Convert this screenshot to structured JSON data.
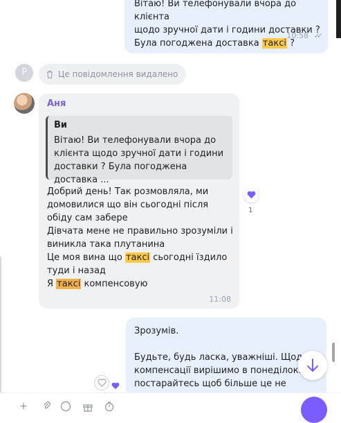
{
  "colors": {
    "accent": "#7b5cff",
    "highlight": "#ffc94a",
    "outgoing_bg": "#e9f0fd",
    "incoming_bg": "#f0f1f3"
  },
  "messages": {
    "outgoing1": {
      "line1": "Вітаю! Ви телефонували вчора до клієнта",
      "line2": "щодо зручної дати і години доставки ?",
      "line3_before": "Була погоджена доставка ",
      "line3_highlight": "таксі",
      "line3_after": " ?",
      "time": "10:58",
      "read_icon": "double-check-icon"
    },
    "deleted": {
      "avatar_letter": "Р",
      "text": "Це повідомлення видалено",
      "icon": "trash-icon"
    },
    "incoming": {
      "sender": "Аня",
      "quote_author": "Ви",
      "quote_text": "Вітаю! Ви телефонували вчора до клієнта щодо зручної дати і години доставки ? Була погоджена доставка ...",
      "p1": "Добрий день! Так розмовляла, ми домовилися що він сьогодні після обіду сам забере",
      "p2": "Дівчата мене не правильно зрозуміли і виникла така плутанина",
      "p3_before": "Це моя вина що ",
      "p3_highlight": "таксі",
      "p3_after": " сьогодні їздило туди і назад",
      "p4_before": "Я ",
      "p4_highlight": "таксі",
      "p4_after": " компенсовую",
      "time": "11:08",
      "reaction_icon": "heart-icon",
      "reaction_count": "1"
    },
    "outgoing2": {
      "p1": "Зрозумів.",
      "p2": "Будьте, будь ласка, уважніші. Щодо компенсації вирішимо в понеділок. І постарайтесь щоб більше це не"
    }
  },
  "controls": {
    "scroll_down_icon": "arrow-down-icon",
    "composer_tools": [
      "plus-icon",
      "attach-icon",
      "emoji-icon",
      "gift-icon",
      "timer-icon"
    ],
    "send_icon": "send-icon"
  }
}
